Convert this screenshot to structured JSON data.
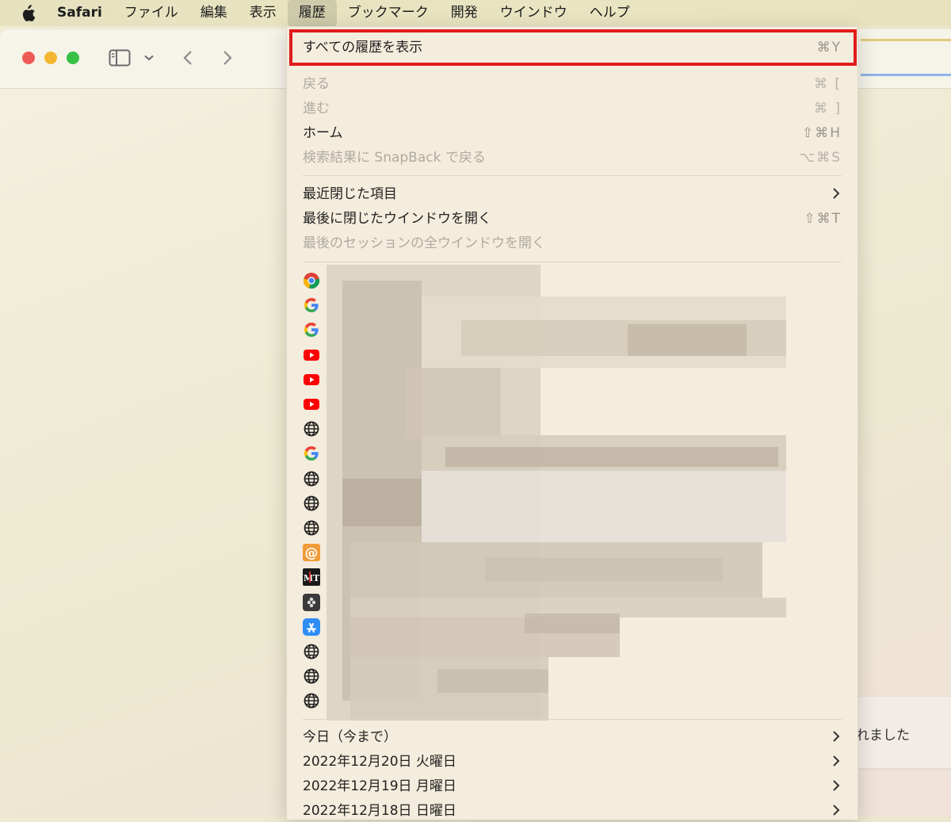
{
  "menubar": {
    "app": "Safari",
    "items": [
      "ファイル",
      "編集",
      "表示",
      "履歴",
      "ブックマーク",
      "開発",
      "ウインドウ",
      "ヘルプ"
    ],
    "active": "履歴"
  },
  "menu": {
    "show_all": {
      "label": "すべての履歴を表示",
      "shortcut": "⌘Y"
    },
    "back": {
      "label": "戻る",
      "shortcut": "⌘ ["
    },
    "forward": {
      "label": "進む",
      "shortcut": "⌘ ]"
    },
    "home": {
      "label": "ホーム",
      "shortcut": "⇧⌘H"
    },
    "snapback": {
      "label": "検索結果に SnapBack で戻る",
      "shortcut": "⌥⌘S"
    },
    "recently_closed": {
      "label": "最近閉じた項目"
    },
    "reopen_window": {
      "label": "最後に閉じたウインドウを開く",
      "shortcut": "⇧⌘T"
    },
    "reopen_session": {
      "label": "最後のセッションの全ウインドウを開く"
    },
    "history_icons": [
      "chrome-icon",
      "google-icon",
      "google-icon",
      "youtube-icon",
      "youtube-icon",
      "youtube-icon",
      "globe-icon",
      "google-icon",
      "globe-icon",
      "globe-icon",
      "globe-icon",
      "at-sign-icon",
      "mt-icon",
      "dark-app-icon",
      "app-store-icon",
      "globe-icon",
      "globe-icon",
      "globe-icon"
    ],
    "days": [
      {
        "label": "今日（今まで）"
      },
      {
        "label": "2022年12月20日 火曜日"
      },
      {
        "label": "2022年12月19日 月曜日"
      },
      {
        "label": "2022年12月18日 日曜日"
      }
    ]
  },
  "notice": {
    "text": "れました"
  },
  "colors": {
    "highlight": "#e01c1c",
    "red": "#ee5b56",
    "yellow": "#f4b531",
    "green": "#38c147"
  }
}
